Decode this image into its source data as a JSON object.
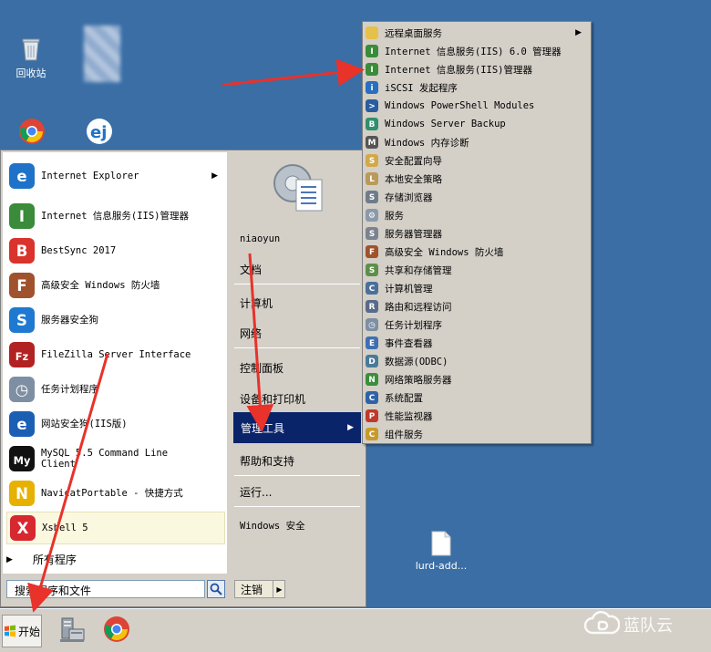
{
  "desktop": {
    "recycle_bin": "回收站",
    "file_label": "lurd-add..."
  },
  "start_menu": {
    "left_items": [
      {
        "label": "Internet Explorer",
        "icon": "ie-icon"
      },
      {
        "label": "Internet 信息服务(IIS)管理器",
        "icon": "iis-manager-icon"
      },
      {
        "label": "BestSync 2017",
        "icon": "bestsync-icon"
      },
      {
        "label": "高级安全 Windows 防火墙",
        "icon": "firewall-icon"
      },
      {
        "label": "服务器安全狗",
        "icon": "safedog-icon"
      },
      {
        "label": "FileZilla Server Interface",
        "icon": "filezilla-icon"
      },
      {
        "label": "任务计划程序",
        "icon": "task-scheduler-icon"
      },
      {
        "label": "网站安全狗(IIS版)",
        "icon": "website-safedog-icon"
      },
      {
        "label": "MySQL 5.5 Command Line Client",
        "icon": "mysql-icon"
      },
      {
        "label": "NavicatPortable - 快捷方式",
        "icon": "navicat-icon"
      },
      {
        "label": "Xshell 5",
        "icon": "xshell-icon"
      }
    ],
    "all_programs": "所有程序",
    "search_placeholder": "搜索程序和文件",
    "user_name": "niaoyun",
    "right_items": {
      "documents": "文档",
      "computer": "计算机",
      "network": "网络",
      "control_panel": "控制面板",
      "devices_printers": "设备和打印机",
      "admin_tools": "管理工具",
      "help_support": "帮助和支持",
      "run": "运行...",
      "windows_security": "Windows 安全"
    },
    "logoff": "注销"
  },
  "admin_submenu": [
    {
      "label": "远程桌面服务",
      "icon": "folder-icon",
      "has_arrow": true
    },
    {
      "label": "Internet 信息服务(IIS) 6.0 管理器",
      "icon": "iis6-icon"
    },
    {
      "label": "Internet 信息服务(IIS)管理器",
      "icon": "iis-icon"
    },
    {
      "label": "iSCSI 发起程序",
      "icon": "iscsi-icon"
    },
    {
      "label": "Windows PowerShell Modules",
      "icon": "powershell-icon"
    },
    {
      "label": "Windows Server Backup",
      "icon": "backup-icon"
    },
    {
      "label": "Windows 内存诊断",
      "icon": "memory-diagnostic-icon"
    },
    {
      "label": "安全配置向导",
      "icon": "security-wizard-icon"
    },
    {
      "label": "本地安全策略",
      "icon": "local-policy-icon"
    },
    {
      "label": "存储浏览器",
      "icon": "storage-explorer-icon"
    },
    {
      "label": "服务",
      "icon": "services-icon"
    },
    {
      "label": "服务器管理器",
      "icon": "server-manager-icon"
    },
    {
      "label": "高级安全 Windows 防火墙",
      "icon": "firewall-icon"
    },
    {
      "label": "共享和存储管理",
      "icon": "share-storage-icon"
    },
    {
      "label": "计算机管理",
      "icon": "computer-management-icon"
    },
    {
      "label": "路由和远程访问",
      "icon": "routing-icon"
    },
    {
      "label": "任务计划程序",
      "icon": "task-scheduler-icon"
    },
    {
      "label": "事件查看器",
      "icon": "event-viewer-icon"
    },
    {
      "label": "数据源(ODBC)",
      "icon": "odbc-icon"
    },
    {
      "label": "网络策略服务器",
      "icon": "nps-icon"
    },
    {
      "label": "系统配置",
      "icon": "msconfig-icon"
    },
    {
      "label": "性能监视器",
      "icon": "perfmon-icon"
    },
    {
      "label": "组件服务",
      "icon": "component-services-icon"
    }
  ],
  "taskbar": {
    "start_label": "开始"
  },
  "watermark": "蓝队云",
  "colors": {
    "desktop": "#3a6ea5",
    "highlight": "#0a246a",
    "arrow": "#e8322a"
  }
}
